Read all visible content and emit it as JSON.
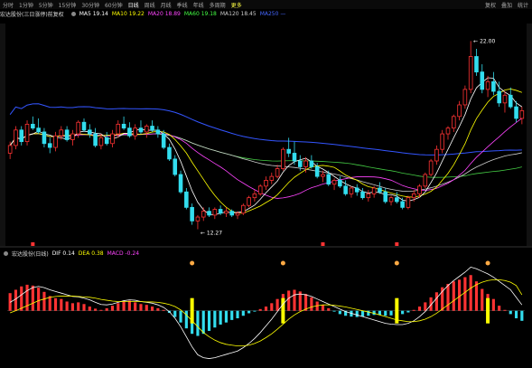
{
  "topbar": {
    "tabs": [
      "分时",
      "1分钟",
      "5分钟",
      "15分钟",
      "30分钟",
      "60分钟",
      "日线",
      "周线",
      "月线",
      "季线",
      "年线",
      "多周期"
    ],
    "active_tab_index": 6,
    "more_label": "更多",
    "right_items": [
      "复权",
      "叠加",
      "统计"
    ]
  },
  "infobar": {
    "title": "宏达股份(三日涨停)前复权",
    "ma_labels": [
      {
        "name": "MA5",
        "value": "19.14",
        "color": "#ffffff"
      },
      {
        "name": "MA10",
        "value": "19.22",
        "color": "#ffff00"
      },
      {
        "name": "MA20",
        "value": "18.89",
        "color": "#ff44ff"
      },
      {
        "name": "MA60",
        "value": "19.18",
        "color": "#44ff44"
      },
      {
        "name": "MA120",
        "value": "18.45",
        "color": "#cccccc"
      },
      {
        "name": "MA250",
        "value": "—",
        "color": "#4466ff"
      }
    ]
  },
  "macd_header": {
    "title": "宏达股份(日线)",
    "items": [
      {
        "name": "DIF",
        "value": "0.14",
        "color": "#ffffff"
      },
      {
        "name": "DEA",
        "value": "0.38",
        "color": "#ffff00"
      },
      {
        "name": "MACD",
        "value": "-0.24",
        "color": "#ff44ff"
      }
    ]
  },
  "annotations": {
    "high_price": "22.00",
    "low_price": "12.27"
  },
  "colors": {
    "up": "#ff3333",
    "down": "#33ddee",
    "ma5": "#ffffff",
    "ma10": "#ffff00",
    "ma20": "#ff44ff",
    "ma60": "#44cc44",
    "ma120": "#cccccc",
    "ma250": "#3355ff",
    "dif": "#ffffff",
    "dea": "#ffff00",
    "signal": "#ffff00"
  },
  "chart_data": {
    "type": "candlestick",
    "ylim": [
      11.5,
      23.0
    ],
    "candles": [
      [
        16.2,
        16.8,
        15.9,
        16.6
      ],
      [
        16.6,
        17.6,
        16.4,
        17.4
      ],
      [
        17.4,
        17.6,
        16.6,
        16.8
      ],
      [
        16.8,
        17.9,
        16.6,
        17.7
      ],
      [
        17.7,
        18.1,
        17.4,
        17.5
      ],
      [
        17.5,
        18.0,
        17.2,
        17.3
      ],
      [
        17.3,
        17.5,
        16.5,
        16.7
      ],
      [
        16.7,
        17.0,
        16.2,
        16.5
      ],
      [
        16.5,
        17.3,
        16.3,
        17.1
      ],
      [
        17.1,
        17.6,
        16.9,
        17.4
      ],
      [
        17.4,
        17.6,
        16.8,
        16.9
      ],
      [
        16.9,
        17.4,
        16.6,
        17.2
      ],
      [
        17.2,
        17.9,
        17.0,
        17.8
      ],
      [
        17.8,
        18.0,
        17.3,
        17.4
      ],
      [
        17.4,
        17.7,
        17.0,
        17.2
      ],
      [
        17.2,
        17.5,
        16.5,
        16.6
      ],
      [
        16.6,
        17.2,
        16.4,
        17.0
      ],
      [
        17.0,
        17.3,
        16.6,
        16.7
      ],
      [
        16.7,
        17.4,
        16.5,
        17.2
      ],
      [
        17.2,
        17.9,
        17.0,
        17.7
      ],
      [
        17.7,
        18.1,
        17.4,
        17.5
      ],
      [
        17.5,
        17.8,
        17.0,
        17.1
      ],
      [
        17.1,
        17.7,
        16.9,
        17.5
      ],
      [
        17.5,
        17.9,
        17.2,
        17.3
      ],
      [
        17.3,
        17.7,
        17.0,
        17.6
      ],
      [
        17.6,
        17.9,
        17.3,
        17.4
      ],
      [
        17.4,
        17.6,
        17.0,
        17.2
      ],
      [
        17.2,
        17.4,
        16.4,
        16.5
      ],
      [
        16.5,
        16.7,
        15.8,
        15.9
      ],
      [
        15.9,
        16.1,
        15.0,
        15.1
      ],
      [
        15.1,
        15.3,
        14.1,
        14.2
      ],
      [
        14.2,
        14.4,
        13.3,
        13.4
      ],
      [
        13.4,
        13.6,
        12.5,
        12.7
      ],
      [
        12.7,
        13.0,
        12.27,
        12.9
      ],
      [
        12.9,
        13.4,
        12.7,
        13.2
      ],
      [
        13.2,
        13.4,
        12.9,
        13.0
      ],
      [
        13.0,
        13.4,
        12.8,
        13.3
      ],
      [
        13.3,
        13.5,
        13.0,
        13.1
      ],
      [
        13.1,
        13.4,
        12.9,
        13.2
      ],
      [
        13.2,
        13.3,
        12.9,
        13.0
      ],
      [
        13.0,
        13.2,
        12.8,
        13.1
      ],
      [
        13.1,
        13.6,
        13.0,
        13.5
      ],
      [
        13.5,
        14.0,
        13.4,
        13.9
      ],
      [
        13.9,
        14.3,
        13.7,
        14.1
      ],
      [
        14.1,
        14.6,
        14.0,
        14.5
      ],
      [
        14.5,
        15.0,
        14.3,
        14.8
      ],
      [
        14.8,
        15.2,
        14.6,
        15.0
      ],
      [
        15.0,
        15.6,
        14.9,
        15.4
      ],
      [
        15.4,
        16.5,
        15.3,
        16.4
      ],
      [
        16.4,
        17.0,
        16.0,
        16.2
      ],
      [
        16.2,
        16.8,
        15.6,
        15.8
      ],
      [
        15.8,
        16.1,
        15.3,
        15.5
      ],
      [
        15.5,
        16.0,
        15.2,
        15.8
      ],
      [
        15.8,
        16.1,
        15.4,
        15.5
      ],
      [
        15.5,
        15.7,
        14.9,
        15.0
      ],
      [
        15.0,
        15.3,
        14.7,
        15.1
      ],
      [
        15.1,
        15.3,
        14.5,
        14.6
      ],
      [
        14.6,
        14.9,
        14.3,
        14.8
      ],
      [
        14.8,
        15.0,
        14.4,
        14.5
      ],
      [
        14.5,
        14.8,
        14.0,
        14.1
      ],
      [
        14.1,
        14.5,
        13.9,
        14.4
      ],
      [
        14.4,
        14.6,
        14.0,
        14.2
      ],
      [
        14.2,
        14.4,
        13.8,
        13.9
      ],
      [
        13.9,
        14.3,
        13.7,
        14.1
      ],
      [
        14.1,
        14.5,
        13.9,
        14.4
      ],
      [
        14.4,
        14.7,
        14.1,
        14.2
      ],
      [
        14.2,
        14.4,
        13.6,
        13.7
      ],
      [
        13.7,
        14.0,
        13.5,
        13.9
      ],
      [
        13.9,
        14.2,
        13.6,
        13.7
      ],
      [
        13.7,
        13.9,
        13.3,
        13.4
      ],
      [
        13.4,
        14.0,
        13.3,
        13.9
      ],
      [
        13.9,
        14.3,
        13.7,
        14.1
      ],
      [
        14.1,
        14.6,
        13.9,
        14.5
      ],
      [
        14.5,
        15.2,
        14.4,
        15.1
      ],
      [
        15.1,
        15.9,
        15.0,
        15.8
      ],
      [
        15.8,
        16.6,
        15.6,
        16.4
      ],
      [
        16.4,
        17.4,
        16.2,
        17.2
      ],
      [
        17.2,
        17.6,
        16.9,
        17.5
      ],
      [
        17.5,
        18.2,
        17.3,
        18.1
      ],
      [
        18.1,
        18.9,
        17.9,
        18.7
      ],
      [
        18.7,
        19.7,
        18.5,
        19.5
      ],
      [
        19.5,
        22.0,
        19.3,
        21.2
      ],
      [
        21.2,
        21.6,
        20.2,
        20.4
      ],
      [
        20.4,
        20.8,
        19.3,
        19.5
      ],
      [
        19.5,
        20.2,
        19.1,
        19.9
      ],
      [
        19.9,
        20.4,
        19.2,
        19.4
      ],
      [
        19.4,
        19.9,
        18.6,
        18.8
      ],
      [
        18.8,
        19.4,
        18.3,
        19.2
      ],
      [
        19.2,
        19.6,
        18.5,
        18.6
      ],
      [
        18.6,
        18.9,
        17.8,
        18.0
      ],
      [
        18.0,
        18.6,
        17.7,
        18.4
      ]
    ],
    "macd": {
      "hist": [
        0.42,
        0.5,
        0.58,
        0.62,
        0.6,
        0.55,
        0.45,
        0.35,
        0.3,
        0.28,
        0.22,
        0.18,
        0.2,
        0.16,
        0.1,
        0.05,
        0.02,
        0.06,
        0.12,
        0.18,
        0.22,
        0.24,
        0.2,
        0.16,
        0.14,
        0.1,
        0.06,
        0.02,
        -0.05,
        -0.15,
        -0.28,
        -0.42,
        -0.55,
        -0.6,
        -0.55,
        -0.48,
        -0.4,
        -0.33,
        -0.28,
        -0.22,
        -0.18,
        -0.12,
        -0.06,
        -0.02,
        0.04,
        0.1,
        0.18,
        0.28,
        0.4,
        0.48,
        0.5,
        0.46,
        0.4,
        0.32,
        0.22,
        0.14,
        0.06,
        -0.02,
        -0.08,
        -0.12,
        -0.14,
        -0.15,
        -0.14,
        -0.12,
        -0.1,
        -0.1,
        -0.12,
        -0.11,
        -0.09,
        -0.08,
        -0.04,
        0.02,
        0.1,
        0.2,
        0.32,
        0.44,
        0.56,
        0.64,
        0.7,
        0.74,
        0.8,
        0.85,
        0.7,
        0.52,
        0.4,
        0.28,
        0.12,
        0.02,
        -0.08,
        -0.18,
        -0.24
      ],
      "dif": [
        0.2,
        0.28,
        0.38,
        0.48,
        0.55,
        0.58,
        0.55,
        0.5,
        0.46,
        0.42,
        0.38,
        0.34,
        0.33,
        0.3,
        0.26,
        0.2,
        0.15,
        0.14,
        0.16,
        0.2,
        0.24,
        0.26,
        0.25,
        0.22,
        0.2,
        0.18,
        0.14,
        0.08,
        -0.02,
        -0.18,
        -0.38,
        -0.62,
        -0.86,
        -1.05,
        -1.12,
        -1.14,
        -1.12,
        -1.08,
        -1.04,
        -1.0,
        -0.96,
        -0.88,
        -0.78,
        -0.66,
        -0.52,
        -0.36,
        -0.2,
        -0.02,
        0.16,
        0.3,
        0.38,
        0.4,
        0.38,
        0.34,
        0.28,
        0.22,
        0.16,
        0.1,
        0.04,
        -0.02,
        -0.06,
        -0.1,
        -0.14,
        -0.18,
        -0.22,
        -0.26,
        -0.3,
        -0.32,
        -0.33,
        -0.33,
        -0.3,
        -0.24,
        -0.14,
        -0.02,
        0.14,
        0.3,
        0.46,
        0.6,
        0.72,
        0.82,
        0.92,
        1.04,
        1.0,
        0.94,
        0.88,
        0.8,
        0.7,
        0.6,
        0.5,
        0.32,
        0.14
      ],
      "dea": [
        -0.05,
        0.0,
        0.06,
        0.12,
        0.18,
        0.24,
        0.28,
        0.32,
        0.34,
        0.35,
        0.35,
        0.35,
        0.34,
        0.33,
        0.32,
        0.3,
        0.27,
        0.25,
        0.23,
        0.22,
        0.22,
        0.22,
        0.22,
        0.22,
        0.21,
        0.21,
        0.2,
        0.18,
        0.15,
        0.1,
        0.02,
        -0.1,
        -0.24,
        -0.38,
        -0.52,
        -0.62,
        -0.7,
        -0.76,
        -0.8,
        -0.82,
        -0.84,
        -0.84,
        -0.82,
        -0.78,
        -0.72,
        -0.64,
        -0.55,
        -0.44,
        -0.32,
        -0.2,
        -0.1,
        -0.02,
        0.04,
        0.09,
        0.12,
        0.14,
        0.14,
        0.13,
        0.11,
        0.09,
        0.06,
        0.03,
        0.0,
        -0.03,
        -0.06,
        -0.1,
        -0.14,
        -0.18,
        -0.22,
        -0.24,
        -0.26,
        -0.26,
        -0.24,
        -0.2,
        -0.14,
        -0.06,
        0.04,
        0.14,
        0.24,
        0.34,
        0.44,
        0.54,
        0.62,
        0.68,
        0.72,
        0.74,
        0.74,
        0.72,
        0.68,
        0.6,
        0.38
      ],
      "signals": [
        32,
        48,
        68,
        84
      ],
      "ylim": [
        -1.3,
        1.2
      ]
    }
  }
}
